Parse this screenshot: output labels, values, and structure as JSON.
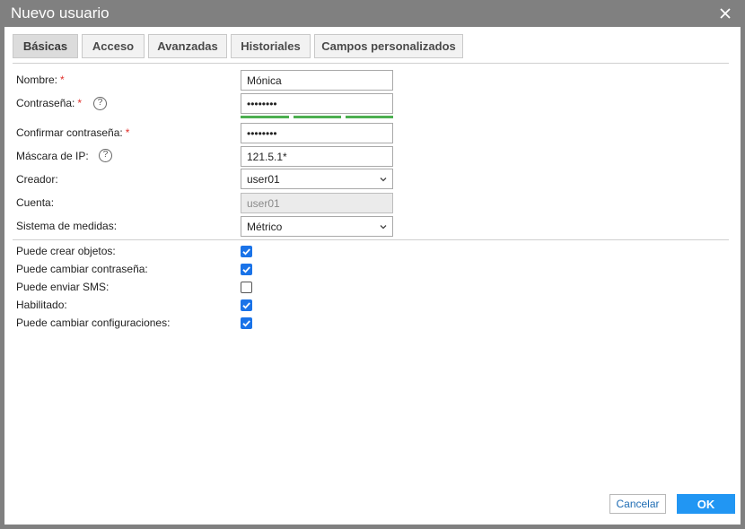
{
  "window": {
    "title": "Nuevo usuario"
  },
  "tabs": [
    {
      "label": "Básicas",
      "active": true
    },
    {
      "label": "Acceso",
      "active": false
    },
    {
      "label": "Avanzadas",
      "active": false
    },
    {
      "label": "Historiales",
      "active": false
    },
    {
      "label": "Campos personalizados",
      "active": false
    }
  ],
  "form": {
    "name": {
      "label": "Nombre:",
      "required": "*",
      "value": "Mónica"
    },
    "password": {
      "label": "Contraseña:",
      "required": "*",
      "value": "••••••••",
      "help": "?",
      "strength_level": 1.0
    },
    "confirm_password": {
      "label": "Confirmar contraseña:",
      "required": "*",
      "value": "••••••••"
    },
    "ip_mask": {
      "label": "Máscara de IP:",
      "value": "121.5.1*",
      "help": "?"
    },
    "creator": {
      "label": "Creador:",
      "value": "user01"
    },
    "account": {
      "label": "Cuenta:",
      "value": "user01"
    },
    "measurement_system": {
      "label": "Sistema de medidas:",
      "value": "Métrico"
    }
  },
  "checkboxes": [
    {
      "label": "Puede crear objetos",
      "label_text": "Puede crear objetos:",
      "checked": true
    },
    {
      "label": "Puede cambiar contraseña",
      "label_text": "Puede cambiar contraseña:",
      "checked": true
    },
    {
      "label": "Puede enviar SMS",
      "label_text": "Puede enviar SMS:",
      "checked": false
    },
    {
      "label": "Habilitado",
      "label_text": "Habilitado:",
      "checked": true
    },
    {
      "label": "Puede cambiar configuraciones",
      "label_text": "Puede cambiar configuraciones:",
      "checked": true
    }
  ],
  "buttons": {
    "cancel": "Cancelar",
    "ok": "OK"
  },
  "colors": {
    "accent": "#2196f3",
    "checkbox": "#1a73e8",
    "strength": "#4caf50",
    "required": "#e0302b",
    "titlebar": "#808080"
  }
}
